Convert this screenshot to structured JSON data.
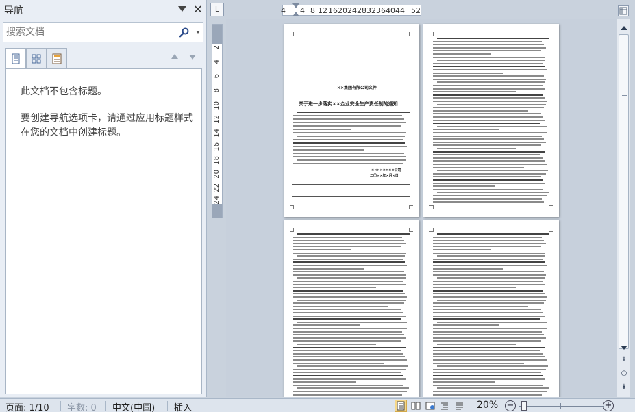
{
  "nav": {
    "title": "导航",
    "search_placeholder": "搜索文档",
    "no_headings": "此文档不包含标题。",
    "hint": "要创建导航选项卡，请通过应用标题样式在您的文档中创建标题。",
    "tabs": [
      "headings",
      "pages",
      "results"
    ]
  },
  "ruler": {
    "corner": "L",
    "horizontal_ticks": [
      "4",
      "4",
      "8",
      "12",
      "16",
      "20",
      "24",
      "28",
      "32",
      "36",
      "40",
      "44",
      "52"
    ],
    "vertical_ticks": [
      "2",
      "4",
      "6",
      "8",
      "10",
      "12",
      "14",
      "16",
      "18",
      "20",
      "22",
      "24"
    ]
  },
  "pages": {
    "p1": {
      "header_line": "××集团有限公司文件",
      "title": "关于进一步落实××企业安全生产责任制的通知",
      "signature1": "××××××××公司",
      "signature2": "二〇××年×月×日"
    }
  },
  "status": {
    "page": "页面: 1/10",
    "words": "字数: 0",
    "language": "中文(中国)",
    "mode": "插入",
    "zoom": "20%",
    "zoom_percent": 20
  },
  "colors": {
    "nav_bg": "#e9eef5",
    "doc_bg": "#c7d0dc",
    "status_bg": "#dde4ed",
    "active_view": "#f6d88a"
  }
}
